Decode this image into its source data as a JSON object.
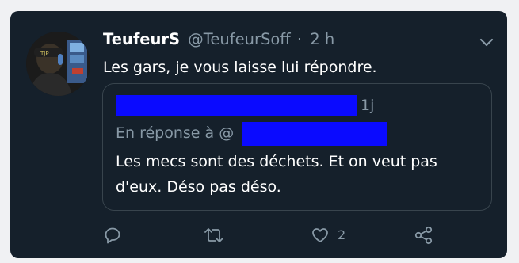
{
  "tweet": {
    "display_name": "TeufeurS",
    "handle": "@TeufeurSoff",
    "separator": "·",
    "time": "2 h",
    "text": "Les gars, je vous laisse lui répondre."
  },
  "quoted_tweet": {
    "time": "1j",
    "reply_prefix": "En réponse à @",
    "text": "Les mecs sont des déchets. Et on veut pas d'eux. Déso pas déso."
  },
  "actions": {
    "like_count": "2"
  },
  "colors": {
    "background": "#15202b",
    "text": "#ffffff",
    "muted": "#8899a6",
    "border": "#38444d",
    "redaction": "#0a0aff"
  },
  "icons": [
    "chevron-down-icon",
    "reply-icon",
    "retweet-icon",
    "heart-icon",
    "share-icon"
  ]
}
